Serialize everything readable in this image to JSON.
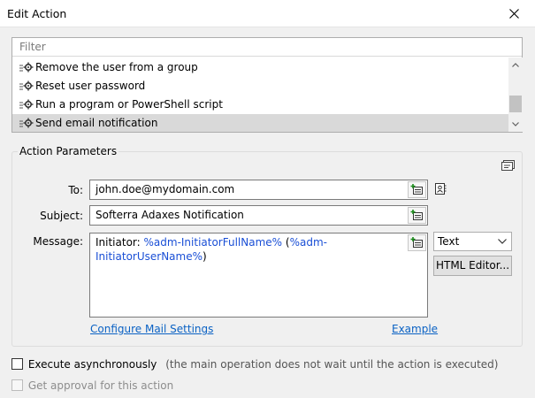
{
  "window": {
    "title": "Edit Action"
  },
  "filter": {
    "placeholder": "Filter"
  },
  "actions": [
    {
      "label": "Remove the user from a group",
      "selected": false
    },
    {
      "label": "Reset user password",
      "selected": false
    },
    {
      "label": "Run a program or PowerShell script",
      "selected": false
    },
    {
      "label": "Send email notification",
      "selected": true
    }
  ],
  "params": {
    "group_title": "Action Parameters",
    "to": {
      "label": "To:",
      "value": "john.doe@mydomain.com"
    },
    "subject": {
      "label": "Subject:",
      "value": "Softerra Adaxes Notification"
    },
    "message": {
      "label": "Message:",
      "prefix": "Initiator: ",
      "var1": "%adm-InitiatorFullName%",
      "mid": " (",
      "var2": "%adm-InitiatorUserName%",
      "suffix": ")"
    },
    "format": {
      "selected": "Text"
    },
    "html_editor_label": "HTML Editor...",
    "configure_link": "Configure Mail Settings",
    "example_link": "Example"
  },
  "options": {
    "async": {
      "label": "Execute asynchronously",
      "note": "(the main operation does not wait until the action is executed)",
      "checked": false
    },
    "approval": {
      "label": "Get approval for this action",
      "checked": false,
      "disabled": true
    }
  },
  "colors": {
    "link": "#0b62c4",
    "variable": "#1a4fd6",
    "selected_row": "#d9d9d9"
  },
  "icons": {
    "action": "gear-icon",
    "insert": "insert-field-icon",
    "contact": "address-book-icon",
    "params": "param-tag-icon",
    "close": "close-icon"
  }
}
